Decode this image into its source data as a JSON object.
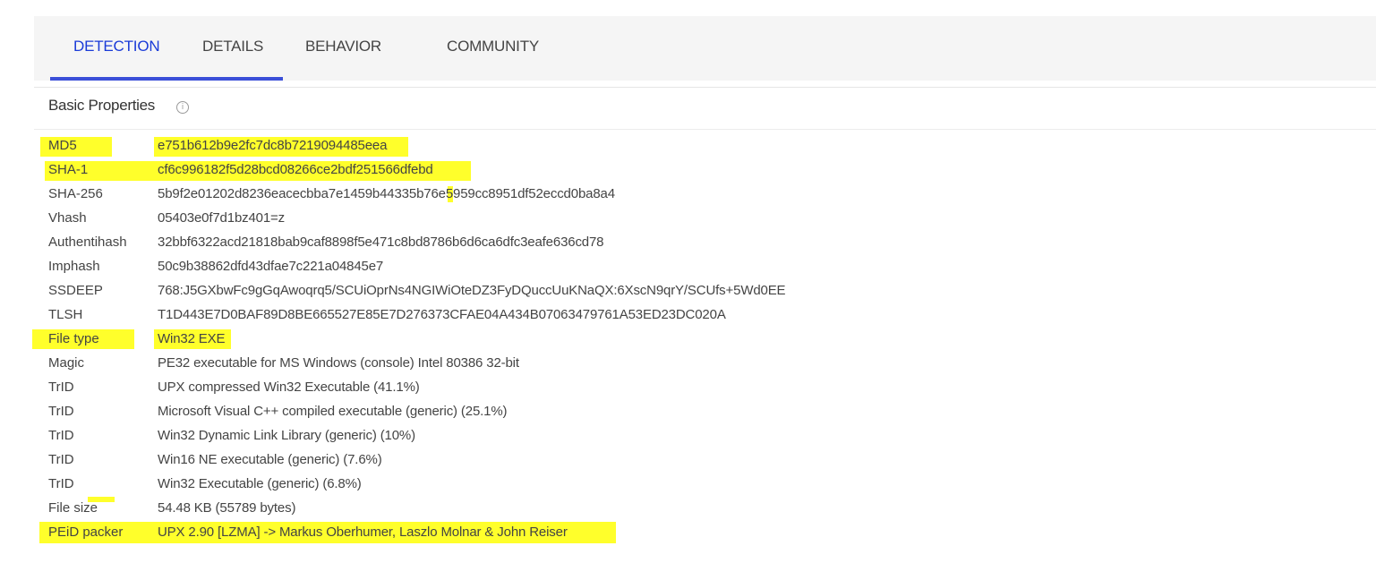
{
  "tabs": [
    {
      "label": "DETECTION",
      "active": true
    },
    {
      "label": "DETAILS",
      "active": false
    },
    {
      "label": "BEHAVIOR",
      "active": false
    },
    {
      "label": "COMMUNITY",
      "active": false
    }
  ],
  "section": {
    "title": "Basic Properties",
    "info_icon": "info-icon"
  },
  "properties": [
    {
      "key": "MD5",
      "value": "e751b612b9e2fc7dc8b7219094485eea",
      "highlighted": true
    },
    {
      "key": "SHA-1",
      "value": "cf6c996182f5d28bcd08266ce2bdf251566dfebd",
      "highlighted": true
    },
    {
      "key": "SHA-256",
      "value": "5b9f2e01202d8236eacecbba7e1459b44335b76e5959cc8951df52eccd0ba8a4",
      "highlighted": false
    },
    {
      "key": "Vhash",
      "value": "05403e0f7d1bz401=z",
      "highlighted": false
    },
    {
      "key": "Authentihash",
      "value": "32bbf6322acd21818bab9caf8898f5e471c8bd8786b6d6ca6dfc3eafe636cd78",
      "highlighted": false
    },
    {
      "key": "Imphash",
      "value": "50c9b38862dfd43dfae7c221a04845e7",
      "highlighted": false
    },
    {
      "key": "SSDEEP",
      "value": "768:J5GXbwFc9gGqAwoqrq5/SCUiOprNs4NGIWiOteDZ3FyDQuccUuKNaQX:6XscN9qrY/SCUfs+5Wd0EE",
      "highlighted": false
    },
    {
      "key": "TLSH",
      "value": "T1D443E7D0BAF89D8BE665527E85E7D276373CFAE04A434B07063479761A53ED23DC020A",
      "highlighted": false
    },
    {
      "key": "File type",
      "value": "Win32 EXE",
      "highlighted": true
    },
    {
      "key": "Magic",
      "value": "PE32 executable for MS Windows (console) Intel 80386 32-bit",
      "highlighted": false
    },
    {
      "key": "TrID",
      "value": "UPX compressed Win32 Executable (41.1%)",
      "highlighted": false
    },
    {
      "key": "TrID",
      "value": "Microsoft Visual C++ compiled executable (generic) (25.1%)",
      "highlighted": false
    },
    {
      "key": "TrID",
      "value": "Win32 Dynamic Link Library (generic) (10%)",
      "highlighted": false
    },
    {
      "key": "TrID",
      "value": "Win16 NE executable (generic) (7.6%)",
      "highlighted": false
    },
    {
      "key": "TrID",
      "value": "Win32 Executable (generic) (6.8%)",
      "highlighted": false
    },
    {
      "key": "File size",
      "value": "54.48 KB (55789 bytes)",
      "highlighted": false
    },
    {
      "key": "PEiD packer",
      "value": "UPX 2.90 [LZMA] -> Markus Oberhumer, Laszlo Molnar & John Reiser",
      "highlighted": true
    }
  ],
  "colors": {
    "active_tab": "#1a3bd8",
    "tab_underline": "#3b4fd8",
    "highlight": "#ffff2b",
    "text": "#444444"
  }
}
